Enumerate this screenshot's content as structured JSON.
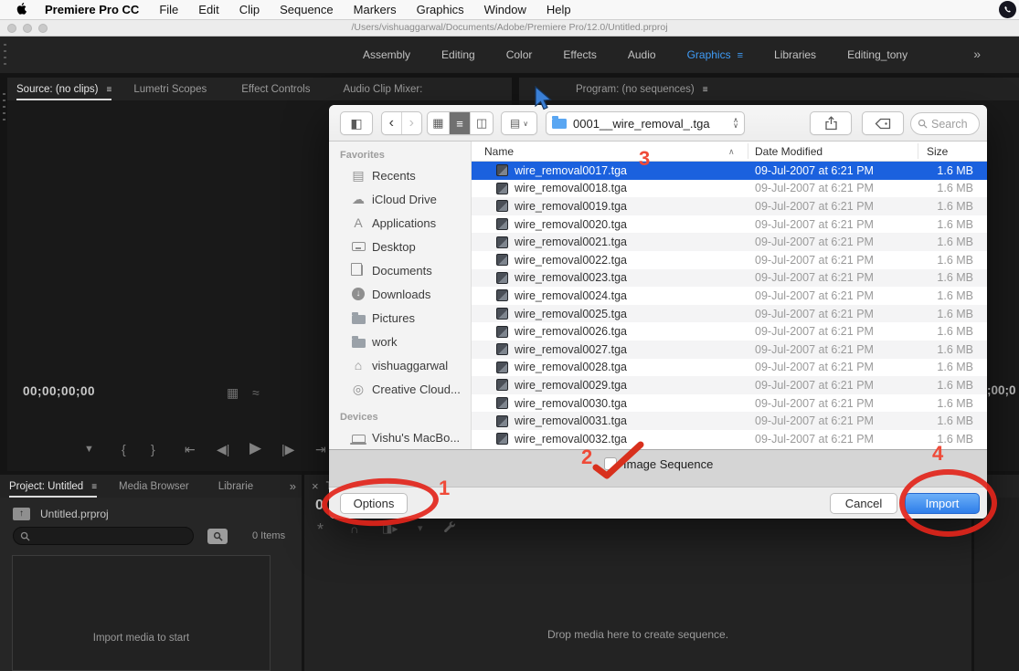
{
  "menu_bar": {
    "app_name": "Premiere Pro CC",
    "items": [
      "File",
      "Edit",
      "Clip",
      "Sequence",
      "Markers",
      "Graphics",
      "Window",
      "Help"
    ]
  },
  "title_bar": {
    "path": "/Users/vishuaggarwal/Documents/Adobe/Premiere Pro/12.0/Untitled.prproj"
  },
  "workspace": {
    "tabs": [
      "Assembly",
      "Editing",
      "Color",
      "Effects",
      "Audio",
      "Graphics",
      "Libraries",
      "Editing_tony"
    ],
    "active": "Graphics",
    "overflow": "»"
  },
  "monitors": {
    "left_tabs": [
      "Source: (no clips)",
      "Lumetri Scopes",
      "Effect Controls",
      "Audio Clip Mixer:"
    ],
    "program_tab": "Program: (no sequences)",
    "source_timecode": "00;00;00;00",
    "program_timecode_partial": ";00;0"
  },
  "timeline": {
    "close_glyph": "×",
    "tab_partial": "T",
    "timecode_partial": "0",
    "drop_text": "Drop media here to create sequence."
  },
  "project": {
    "tabs": [
      "Project: Untitled",
      "Media Browser",
      "Librarie"
    ],
    "overflow": "»",
    "file_name": "Untitled.prproj",
    "items_count": "0 Items",
    "empty_text": "Import media to start"
  },
  "dialog": {
    "folder_dropdown": "0001__wire_removal_.tga",
    "search_placeholder": "Search",
    "sidebar": {
      "favorites_label": "Favorites",
      "favorites": [
        {
          "icon": "recents",
          "label": "Recents"
        },
        {
          "icon": "cloud",
          "label": "iCloud Drive"
        },
        {
          "icon": "applications",
          "label": "Applications"
        },
        {
          "icon": "desktop",
          "label": "Desktop"
        },
        {
          "icon": "documents",
          "label": "Documents"
        },
        {
          "icon": "download",
          "label": "Downloads"
        },
        {
          "icon": "folder",
          "label": "Pictures"
        },
        {
          "icon": "folder",
          "label": "work"
        },
        {
          "icon": "home",
          "label": "vishuaggarwal"
        },
        {
          "icon": "cc",
          "label": "Creative Cloud..."
        }
      ],
      "devices_label": "Devices",
      "devices": [
        {
          "icon": "laptop",
          "label": "Vishu's MacBo..."
        }
      ]
    },
    "columns": {
      "name": "Name",
      "date": "Date Modified",
      "size": "Size"
    },
    "selected_index": 0,
    "files": [
      {
        "name": "wire_removal0017.tga",
        "date": "09-Jul-2007 at 6:21 PM",
        "size": "1.6 MB"
      },
      {
        "name": "wire_removal0018.tga",
        "date": "09-Jul-2007 at 6:21 PM",
        "size": "1.6 MB"
      },
      {
        "name": "wire_removal0019.tga",
        "date": "09-Jul-2007 at 6:21 PM",
        "size": "1.6 MB"
      },
      {
        "name": "wire_removal0020.tga",
        "date": "09-Jul-2007 at 6:21 PM",
        "size": "1.6 MB"
      },
      {
        "name": "wire_removal0021.tga",
        "date": "09-Jul-2007 at 6:21 PM",
        "size": "1.6 MB"
      },
      {
        "name": "wire_removal0022.tga",
        "date": "09-Jul-2007 at 6:21 PM",
        "size": "1.6 MB"
      },
      {
        "name": "wire_removal0023.tga",
        "date": "09-Jul-2007 at 6:21 PM",
        "size": "1.6 MB"
      },
      {
        "name": "wire_removal0024.tga",
        "date": "09-Jul-2007 at 6:21 PM",
        "size": "1.6 MB"
      },
      {
        "name": "wire_removal0025.tga",
        "date": "09-Jul-2007 at 6:21 PM",
        "size": "1.6 MB"
      },
      {
        "name": "wire_removal0026.tga",
        "date": "09-Jul-2007 at 6:21 PM",
        "size": "1.6 MB"
      },
      {
        "name": "wire_removal0027.tga",
        "date": "09-Jul-2007 at 6:21 PM",
        "size": "1.6 MB"
      },
      {
        "name": "wire_removal0028.tga",
        "date": "09-Jul-2007 at 6:21 PM",
        "size": "1.6 MB"
      },
      {
        "name": "wire_removal0029.tga",
        "date": "09-Jul-2007 at 6:21 PM",
        "size": "1.6 MB"
      },
      {
        "name": "wire_removal0030.tga",
        "date": "09-Jul-2007 at 6:21 PM",
        "size": "1.6 MB"
      },
      {
        "name": "wire_removal0031.tga",
        "date": "09-Jul-2007 at 6:21 PM",
        "size": "1.6 MB"
      },
      {
        "name": "wire_removal0032.tga",
        "date": "09-Jul-2007 at 6:21 PM",
        "size": "1.6 MB"
      }
    ],
    "image_sequence_label": "Image Sequence",
    "buttons": {
      "options": "Options",
      "cancel": "Cancel",
      "import": "Import"
    }
  },
  "annotations": {
    "step1": "1",
    "step2": "2",
    "step3": "3",
    "step4": "4"
  },
  "colors": {
    "workspace_accent": "#3f9cf7",
    "selection_blue": "#1b61de",
    "import_blue": "#2e7de9",
    "annotation_red": "#e2251b"
  }
}
